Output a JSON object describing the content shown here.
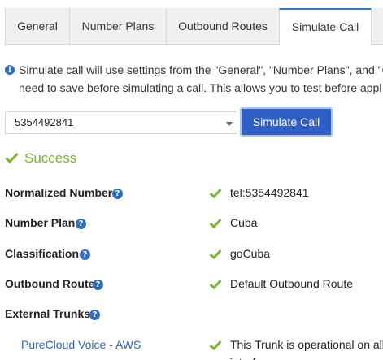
{
  "tabs": [
    {
      "label": "General"
    },
    {
      "label": "Number Plans"
    },
    {
      "label": "Outbound Routes"
    },
    {
      "label": "Simulate Call"
    }
  ],
  "info": {
    "line1": "Simulate call will use settings from the \"General\", \"Number Plans\", and \"O",
    "line2": "need to save before simulating a call. This allows you to test before appl"
  },
  "number_select": {
    "value": "5354492841"
  },
  "simulate_button": {
    "label": "Simulate Call"
  },
  "status": {
    "label": "Success",
    "color": "#76b82a"
  },
  "results": {
    "normalized_number": {
      "label": "Normalized Number",
      "value": "tel:5354492841"
    },
    "number_plan": {
      "label": "Number Plan",
      "value": "Cuba"
    },
    "classification": {
      "label": "Classification",
      "value": "goCuba"
    },
    "outbound_route": {
      "label": "Outbound Route",
      "value": "Default Outbound Route"
    },
    "external_trunks": {
      "label": "External Trunks"
    },
    "trunk": {
      "name": "PureCloud Voice - AWS",
      "status": "This Trunk is operational on all",
      "status_line2": "interfaces"
    }
  },
  "colors": {
    "accent": "#2f5fc6",
    "check": "#76b82a",
    "link": "#2f63c2",
    "help": "#2e6ec2"
  }
}
